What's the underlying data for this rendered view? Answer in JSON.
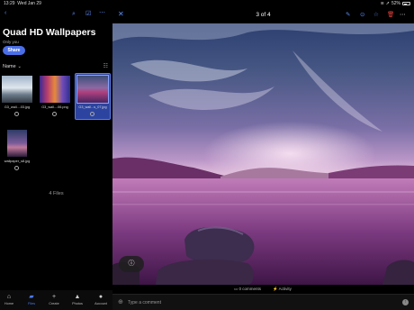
{
  "status_bar": {
    "time": "13:29",
    "date": "Wed Jan 29",
    "battery": "52%",
    "battery_level": 0.52
  },
  "left_panel": {
    "title": "Quad HD Wallpapers",
    "subtitle": "Only you",
    "share_label": "Share",
    "sort_label": "Name",
    "files": [
      {
        "name": "G3_wall....03.jpg",
        "selected": false
      },
      {
        "name": "G3_wall....06.png",
        "selected": false
      },
      {
        "name": "G3_wall...s_07.jpg",
        "selected": true
      },
      {
        "name": "wallpaper_s8.jpg",
        "selected": false
      }
    ],
    "files_count": "4 Files"
  },
  "bottom_nav": [
    {
      "label": "Home",
      "icon": "home-icon"
    },
    {
      "label": "Files",
      "icon": "folder-icon",
      "active": true
    },
    {
      "label": "Create",
      "icon": "plus-icon"
    },
    {
      "label": "Photos",
      "icon": "photos-icon"
    },
    {
      "label": "Account",
      "icon": "person-icon"
    }
  ],
  "viewer": {
    "counter": "3 of 4",
    "comments_label": "0 comments",
    "activity_label": "Activity",
    "comment_placeholder": "Type a comment"
  },
  "colors": {
    "accent": "#4b6fe8",
    "delete": "#e0403a",
    "selected_bg": "#2c43a0"
  }
}
